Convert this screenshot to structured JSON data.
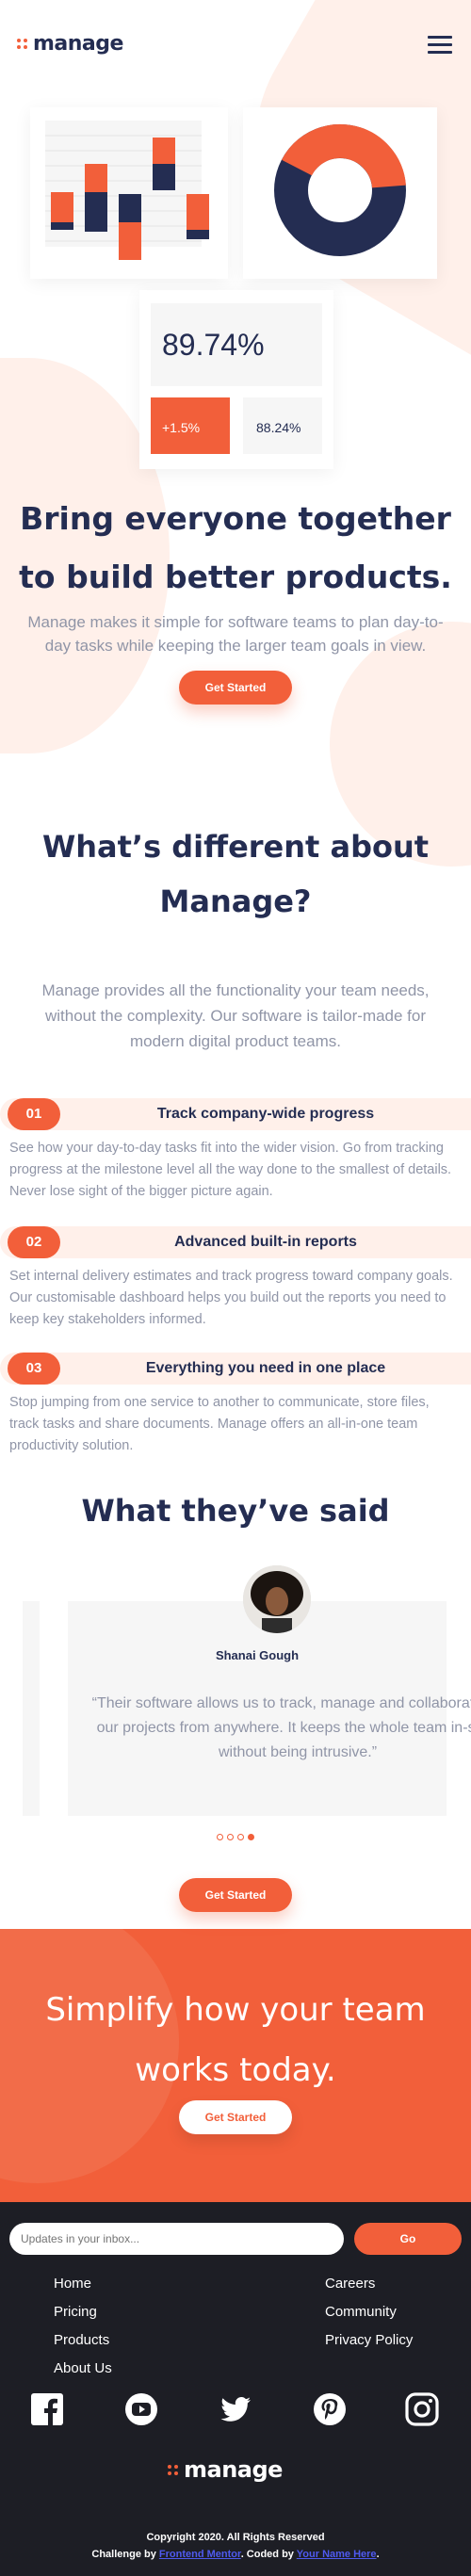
{
  "header": {
    "logo_text": "manage",
    "menu_icon": "hamburger-menu-icon"
  },
  "hero": {
    "stat_main": "89.74%",
    "stat_up": "+1.5%",
    "stat_secondary": "88.24%",
    "title_line1": "Bring everyone together",
    "title_line2": "to build better products.",
    "description": "Manage makes it simple for software teams to plan day-to-day tasks while keeping the larger team goals in view.",
    "cta_label": "Get Started"
  },
  "different": {
    "title": "What’s different about Manage?",
    "description": "Manage provides all the functionality your team needs, without the complexity. Our software is tailor-made for modern digital product teams."
  },
  "features": [
    {
      "num": "01",
      "title": "Track company-wide progress",
      "text": "See how your day-to-day tasks fit into the wider vision. Go from tracking progress at the milestone level all the way done to the smallest of details. Never lose sight of the bigger picture again."
    },
    {
      "num": "02",
      "title": "Advanced built-in reports",
      "text": "Set internal delivery estimates and track progress toward company goals. Our customisable dashboard helps you build out the reports you need to keep key stakeholders informed."
    },
    {
      "num": "03",
      "title": "Everything you need in one place",
      "text": "Stop jumping from one service to another to communicate, store files, track tasks and share documents. Manage offers an all-in-one team productivity solution."
    }
  ],
  "testimonials": {
    "title": "What they’ve said",
    "name": "Shanai Gough",
    "quote": "“Their software allows us to track, manage and collaborate on our projects from anywhere. It keeps the whole team in-sync without being intrusive.”",
    "active_slide": 4,
    "cta_label": "Get Started"
  },
  "cta": {
    "title": "Simplify how your team works today.",
    "button_label": "Get Started"
  },
  "footer": {
    "subscribe_placeholder": "Updates in your inbox...",
    "go_label": "Go",
    "links_left": [
      "Home",
      "Pricing",
      "Products",
      "About Us"
    ],
    "links_right": [
      "Careers",
      "Community",
      "Privacy Policy"
    ],
    "social": [
      "facebook-icon",
      "youtube-icon",
      "twitter-icon",
      "pinterest-icon",
      "instagram-icon"
    ],
    "logo_text": "manage",
    "copyright": "Copyright 2020. All Rights Reserved",
    "credit_prefix": "Challenge by ",
    "credit_challenge": "Frontend Mentor",
    "credit_middle": ". Coded by ",
    "credit_author": "Your Name Here",
    "credit_suffix": "."
  },
  "colors": {
    "accent": "#f25f3a",
    "navy": "#242d52",
    "tint": "#fff0ea",
    "footer_bg": "#1d1e25"
  }
}
